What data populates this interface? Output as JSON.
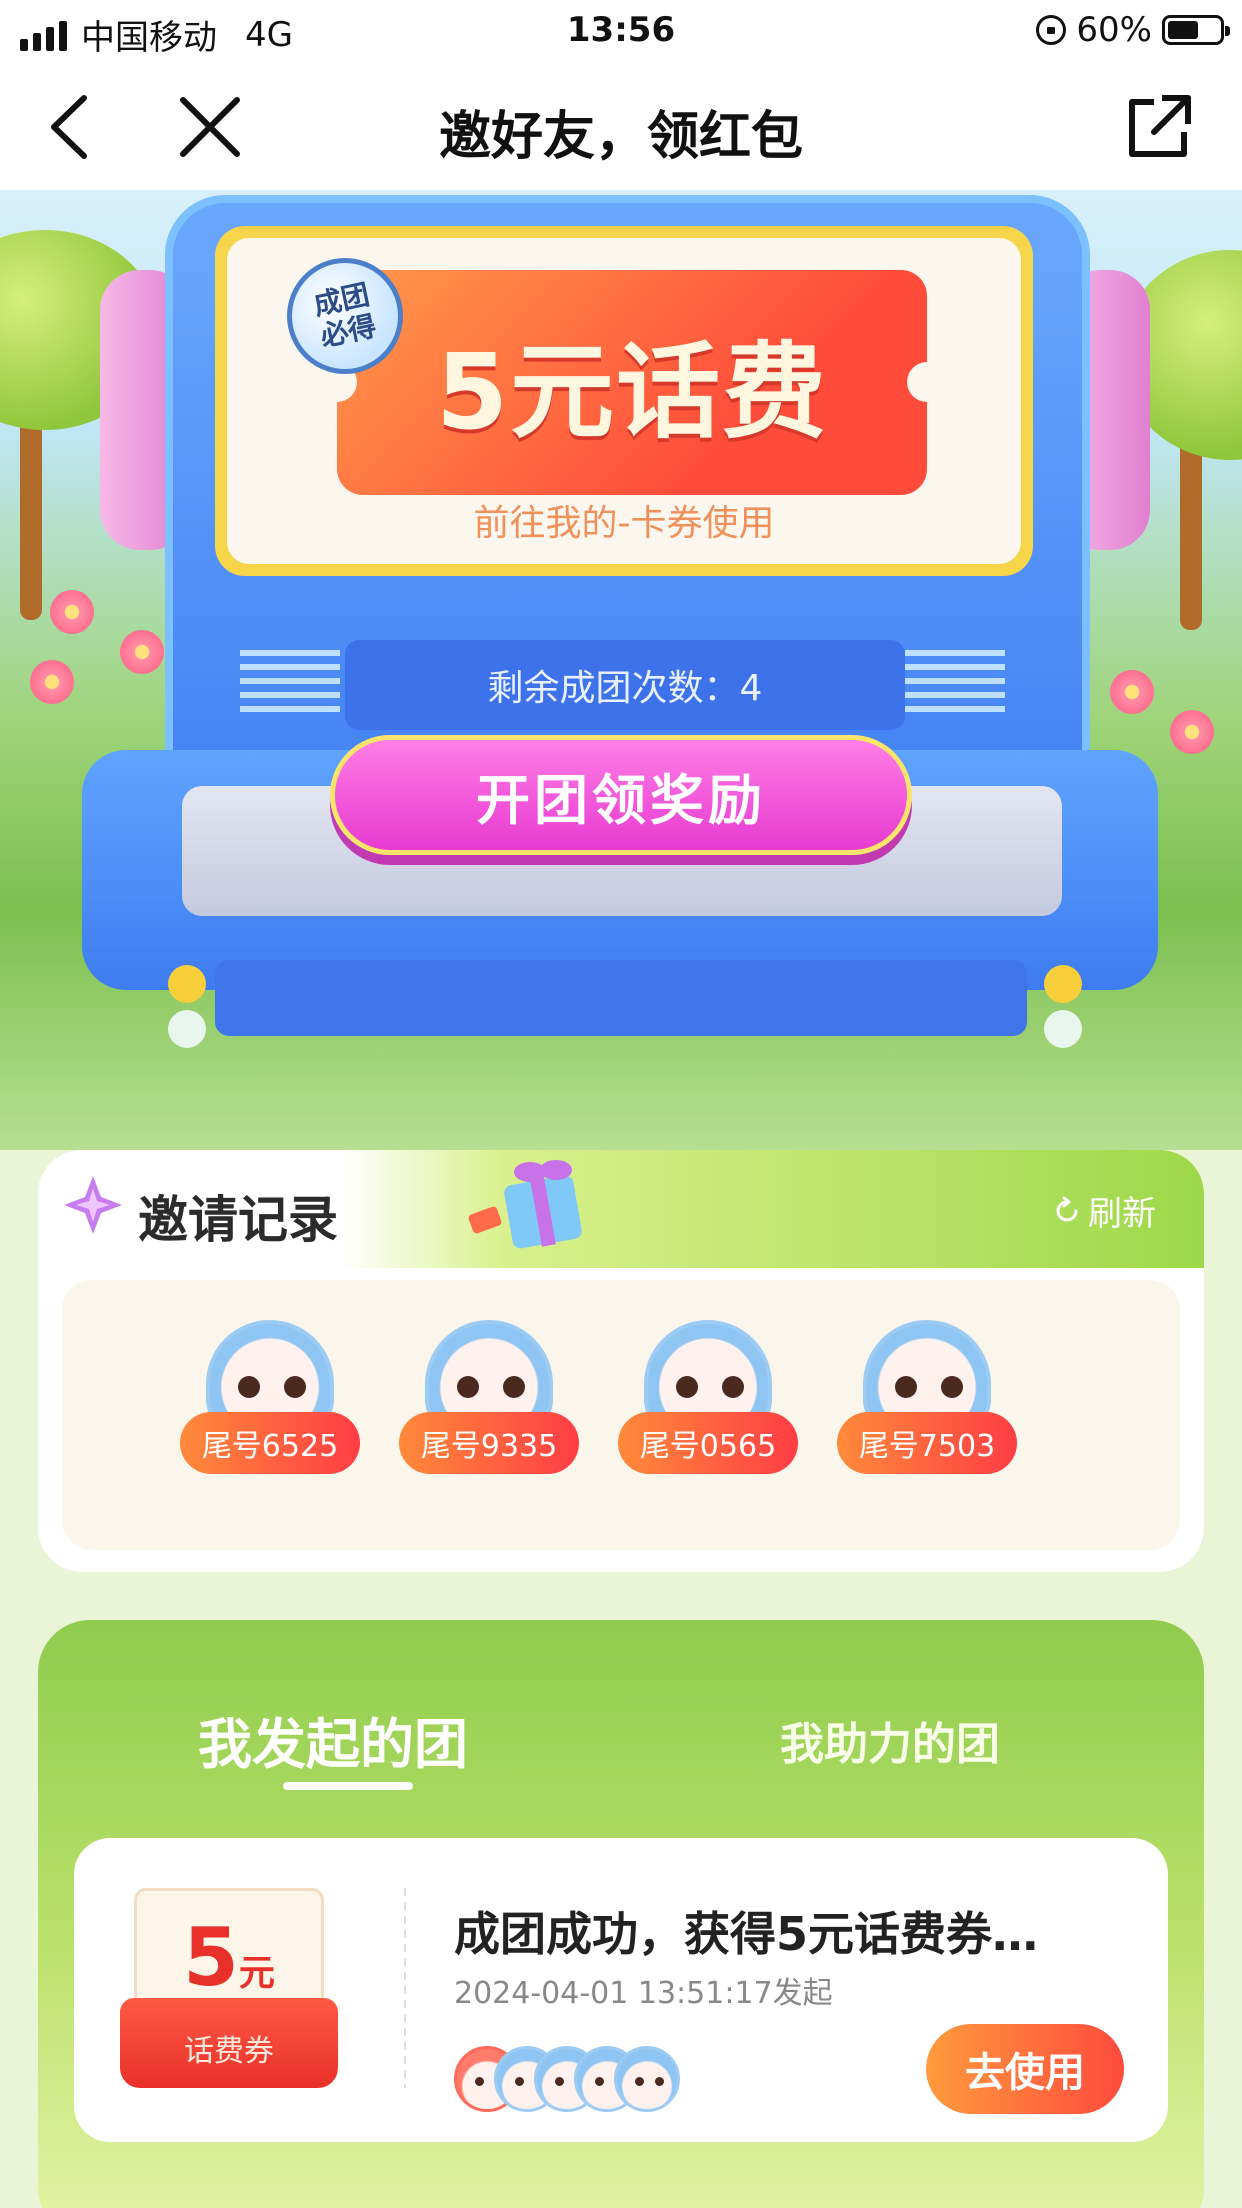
{
  "status_bar": {
    "carrier": "中国移动",
    "network": "4G",
    "time": "13:56",
    "battery": "60%"
  },
  "nav": {
    "title": "邀好友，领红包"
  },
  "hero": {
    "badge": "成团必得",
    "prize": "5元话费",
    "hint": "前往我的-卡券使用",
    "remaining": "剩余成团次数：4",
    "open_button": "开团领奖励"
  },
  "invite": {
    "title": "邀请记录",
    "refresh": "刷新",
    "friends": [
      {
        "tail": "尾号6525"
      },
      {
        "tail": "尾号9335"
      },
      {
        "tail": "尾号0565"
      },
      {
        "tail": "尾号7503"
      }
    ]
  },
  "groups": {
    "tabs": [
      "我发起的团",
      "我助力的团"
    ],
    "active_tab": 0,
    "items": [
      {
        "coupon_amount": "5",
        "coupon_unit": "元",
        "coupon_label": "话费券",
        "title": "成团成功，获得5元话费券…",
        "time": "2024-04-01 13:51:17发起",
        "button": "去使用"
      }
    ]
  },
  "colors": {
    "accent_orange": "#ff4a3d",
    "accent_pink": "#e73ad1",
    "machine_blue": "#3a78f0",
    "grass_green": "#8fcc4e"
  }
}
